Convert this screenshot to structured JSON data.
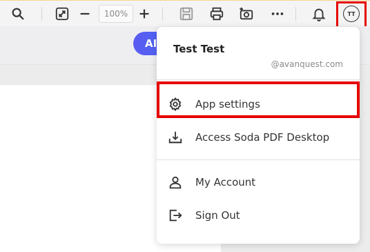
{
  "toolbar": {
    "zoom_value": "100%",
    "icons": [
      "search-icon",
      "expand-icon",
      "zoom-out-icon",
      "zoom-in-icon",
      "save-icon",
      "print-icon",
      "camera-icon",
      "more-icon",
      "bell-icon"
    ],
    "avatar_initials": "TT"
  },
  "subbar": {
    "ai_button_label": "AI"
  },
  "account_menu": {
    "user_name": "Test Test",
    "user_email": "@avanquest.com",
    "items": [
      {
        "label": "App settings",
        "icon": "gear-icon"
      },
      {
        "label": "Access Soda PDF Desktop",
        "icon": "download-desktop-icon"
      },
      {
        "label": "My Account",
        "icon": "person-icon"
      },
      {
        "label": "Sign Out",
        "icon": "sign-out-icon"
      }
    ]
  },
  "colors": {
    "highlight": "#e60000",
    "ai_button": "#4a67f5"
  }
}
